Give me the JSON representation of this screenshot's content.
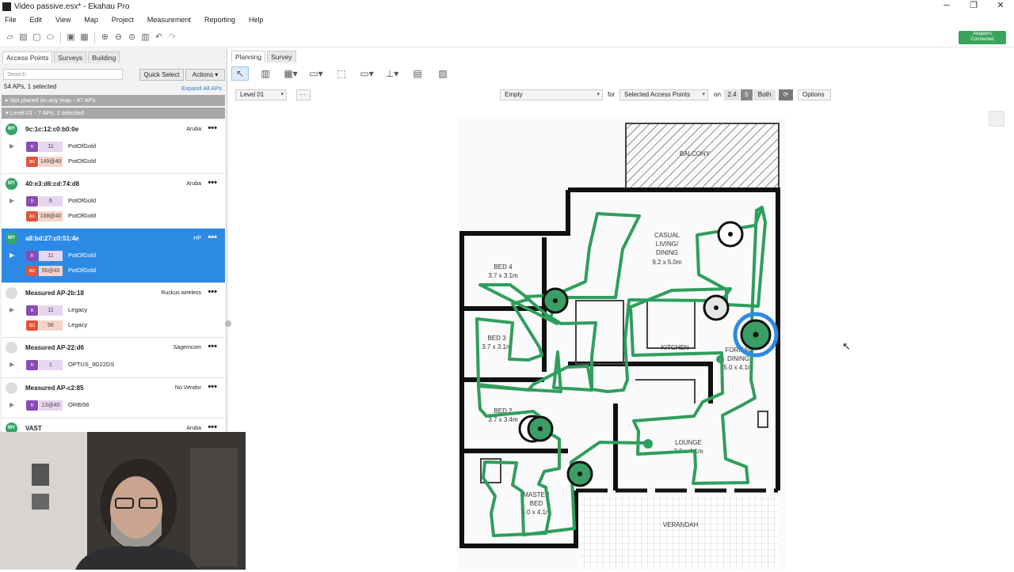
{
  "window": {
    "title": "Video passive.esx* - Ekahau Pro",
    "buttons": [
      "─",
      "❐",
      "✕"
    ]
  },
  "menu": [
    "File",
    "Edit",
    "View",
    "Map",
    "Project",
    "Measurement",
    "Reporting",
    "Help"
  ],
  "status": {
    "adapter_line1": "Adapters",
    "adapter_line2": "Connected",
    "color": "#3aa55a"
  },
  "left_panel": {
    "tabs": [
      "Access Points",
      "Surveys",
      "Building"
    ],
    "search_placeholder": "Search",
    "quick_select": "Quick Select",
    "actions": "Actions",
    "count": "54 APs, 1 selected",
    "expand_all": "Expand All APs",
    "group_not_placed": "▸ Not placed on any map - 47 APs",
    "group_level": "▾ Level 01 - 7 APs, 1 selected",
    "aps": [
      {
        "badge": "MY",
        "name": "9c:1c:12:c0:b0:0e",
        "vendor": "Aruba",
        "radios": [
          {
            "band": "n",
            "channel": "11",
            "ssid": "PotOfGold"
          },
          {
            "band": "ac",
            "channel": "149@40",
            "ssid": "PotOfGold"
          }
        ]
      },
      {
        "badge": "MY",
        "name": "40:e3:d6:cd:74:d8",
        "vendor": "Aruba",
        "radios": [
          {
            "band": "n",
            "channel": "6",
            "ssid": "PotOfGold"
          },
          {
            "band": "ac",
            "channel": "108@40",
            "ssid": "PotOfGold"
          }
        ]
      },
      {
        "badge": "MY",
        "name": "a8:bd:27:c0:51:4e",
        "vendor": "HP",
        "radios": [
          {
            "band": "n",
            "channel": "11",
            "ssid": "PotOfGold"
          },
          {
            "band": "ac",
            "channel": "56@40",
            "ssid": "PotOfGold"
          }
        ]
      },
      {
        "badge": "",
        "name": "Measured AP-2b:18",
        "vendor": "Ruckus wireless",
        "radios": [
          {
            "band": "n",
            "channel": "11",
            "ssid": "Legacy"
          },
          {
            "band": "ac",
            "channel": "56",
            "ssid": "Legacy"
          }
        ]
      },
      {
        "badge": "",
        "name": "Measured AP-22:d6",
        "vendor": "Sagemcom",
        "radios": [
          {
            "band": "n",
            "channel": "1",
            "ssid": "OPTUS_9D22DS"
          }
        ]
      },
      {
        "badge": "",
        "name": "Measured AP-c2:85",
        "vendor": "No Vendor",
        "radios": [
          {
            "band": "n",
            "channel": "13@40",
            "ssid": "ORBI56"
          }
        ]
      },
      {
        "badge": "MY",
        "name": "VAST",
        "vendor": "Aruba",
        "radios": []
      }
    ]
  },
  "right_tabs": [
    "Planning",
    "Survey"
  ],
  "filters": {
    "level": "Level 01",
    "more": "···",
    "visualization": "Empty",
    "for_label": "for",
    "target": "Selected Access Points",
    "on_label": "on",
    "band_24": "2.4",
    "band_5": "5",
    "band_both": "Both",
    "options": "Options"
  },
  "floorplan_labels": {
    "balcony": "BALCONY",
    "casual": "CASUAL",
    "living": "LIVING/",
    "dining": "DINING",
    "casual_dim": "9.2 x 5.0m",
    "bed4": "BED 4",
    "bed4_dim": "3.7 x 3.1m",
    "bed3": "BED 3",
    "bed3_dim": "3.7 x 3.1m",
    "bed2": "BED 2",
    "bed2_dim": "3.7 x 3.4m",
    "kitchen": "KITCHEN",
    "formal": "FORMAL",
    "formal_dining": "DINING",
    "formal_dim": "5.0 x 4.1m",
    "lounge": "LOUNGE",
    "lounge_dim": "7.3 x 4.1m",
    "master": "MASTER",
    "master_bed": "BED",
    "master_dim": "5.0 x 4.1m",
    "verandah": "VERANDAH"
  }
}
